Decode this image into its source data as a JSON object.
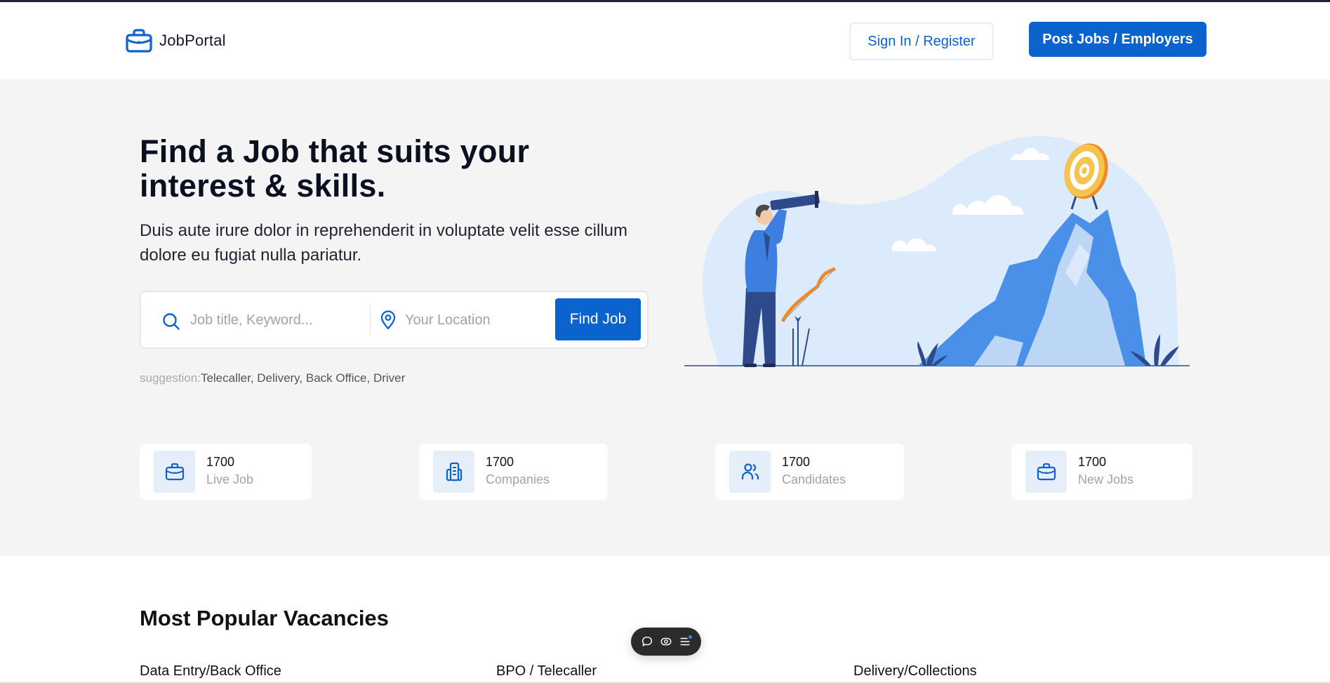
{
  "colors": {
    "brand": "#0b63ce",
    "hero_bg": "#f4f4f4",
    "icon_tile_bg": "#e6eef9"
  },
  "header": {
    "logo_icon": "briefcase-icon",
    "logo_text": "JobPortal",
    "sign_in_label": "Sign In / Register",
    "post_jobs_label": "Post Jobs / Employers"
  },
  "hero": {
    "title": "Find a Job that suits your interest & skills.",
    "subtitle": "Duis aute irure dolor in reprehenderit in voluptate velit esse cillum dolore eu fugiat nulla pariatur.",
    "search": {
      "keyword_icon": "search-icon",
      "keyword_placeholder": "Job title, Keyword...",
      "keyword_value": "",
      "location_icon": "map-pin-icon",
      "location_placeholder": "Your Location",
      "location_value": "",
      "button_label": "Find Job"
    },
    "suggestion": {
      "label": "suggestion:",
      "items": [
        "Telecaller",
        "Delivery",
        "Back Office",
        "Driver"
      ]
    },
    "illustration": "man-with-telescope-and-target-illustration"
  },
  "stats": [
    {
      "icon": "briefcase-icon",
      "value": "1700",
      "label": "Live Job"
    },
    {
      "icon": "building-icon",
      "value": "1700",
      "label": "Companies"
    },
    {
      "icon": "users-icon",
      "value": "1700",
      "label": "Candidates"
    },
    {
      "icon": "briefcase-icon",
      "value": "1700",
      "label": "New Jobs"
    }
  ],
  "popular": {
    "title": "Most Popular Vacancies",
    "columns": [
      "Data Entry/Back Office",
      "BPO / Telecaller",
      "Delivery/Collections"
    ]
  },
  "floating_toolbar": {
    "items": [
      "chat-bubble-icon",
      "eye-icon",
      "menu-icon"
    ]
  }
}
